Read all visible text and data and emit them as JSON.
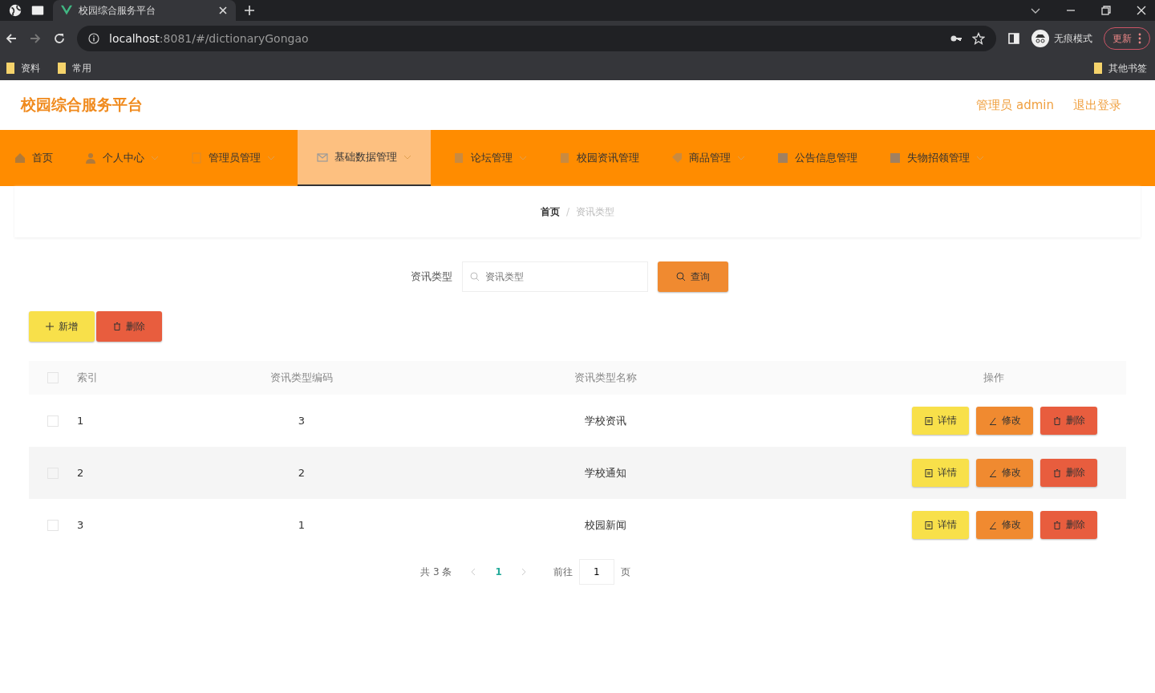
{
  "browser": {
    "tab_title": "校园综合服务平台",
    "url_host": "localhost",
    "url_rest": ":8081/#/dictionaryGongao",
    "profile_label": "无痕模式",
    "update_label": "更新",
    "bookmarks": [
      {
        "label": "资料"
      },
      {
        "label": "常用"
      }
    ],
    "other_bookmarks": "其他书签"
  },
  "header": {
    "title": "校园综合服务平台",
    "user": "管理员 admin",
    "logout": "退出登录"
  },
  "nav": [
    {
      "label": "首页",
      "dropdown": false,
      "selected": false
    },
    {
      "label": "个人中心",
      "dropdown": true,
      "selected": false
    },
    {
      "label": "管理员管理",
      "dropdown": true,
      "selected": false
    },
    {
      "label": "基础数据管理",
      "dropdown": true,
      "selected": true
    },
    {
      "label": "论坛管理",
      "dropdown": true,
      "selected": false
    },
    {
      "label": "校园资讯管理",
      "dropdown": false,
      "selected": false
    },
    {
      "label": "商品管理",
      "dropdown": true,
      "selected": false
    },
    {
      "label": "公告信息管理",
      "dropdown": false,
      "selected": false
    },
    {
      "label": "失物招领管理",
      "dropdown": true,
      "selected": false
    }
  ],
  "breadcrumb": [
    {
      "label": "首页"
    },
    {
      "label": "资讯类型"
    }
  ],
  "breadcrumb_separator": "/",
  "search": {
    "label": "资讯类型",
    "placeholder": "资讯类型",
    "button": "查询"
  },
  "actions": [
    {
      "label": "新增",
      "kind": "add"
    },
    {
      "label": "删除",
      "kind": "delete"
    }
  ],
  "table": {
    "columns": [
      "索引",
      "资讯类型编码",
      "资讯类型名称",
      "操作"
    ],
    "header_checked": false,
    "rows": [
      {
        "index": "1",
        "code": "3",
        "name": "学校资讯",
        "checked": false,
        "buttons": [
          {
            "label": "详情",
            "kind": "detail"
          },
          {
            "label": "修改",
            "kind": "edit"
          },
          {
            "label": "删除",
            "kind": "delete"
          }
        ]
      },
      {
        "index": "2",
        "code": "2",
        "name": "学校通知",
        "checked": false,
        "buttons": [
          {
            "label": "详情",
            "kind": "detail"
          },
          {
            "label": "修改",
            "kind": "edit"
          },
          {
            "label": "删除",
            "kind": "delete"
          }
        ]
      },
      {
        "index": "3",
        "code": "1",
        "name": "校园新闻",
        "checked": false,
        "buttons": [
          {
            "label": "详情",
            "kind": "detail"
          },
          {
            "label": "修改",
            "kind": "edit"
          },
          {
            "label": "删除",
            "kind": "delete"
          }
        ]
      }
    ]
  },
  "pagination": {
    "total": "共 3 条",
    "pages": [
      {
        "label": "1",
        "selected": true
      }
    ],
    "goto": "前往",
    "goto_value": "1",
    "goto_suffix": "页"
  }
}
